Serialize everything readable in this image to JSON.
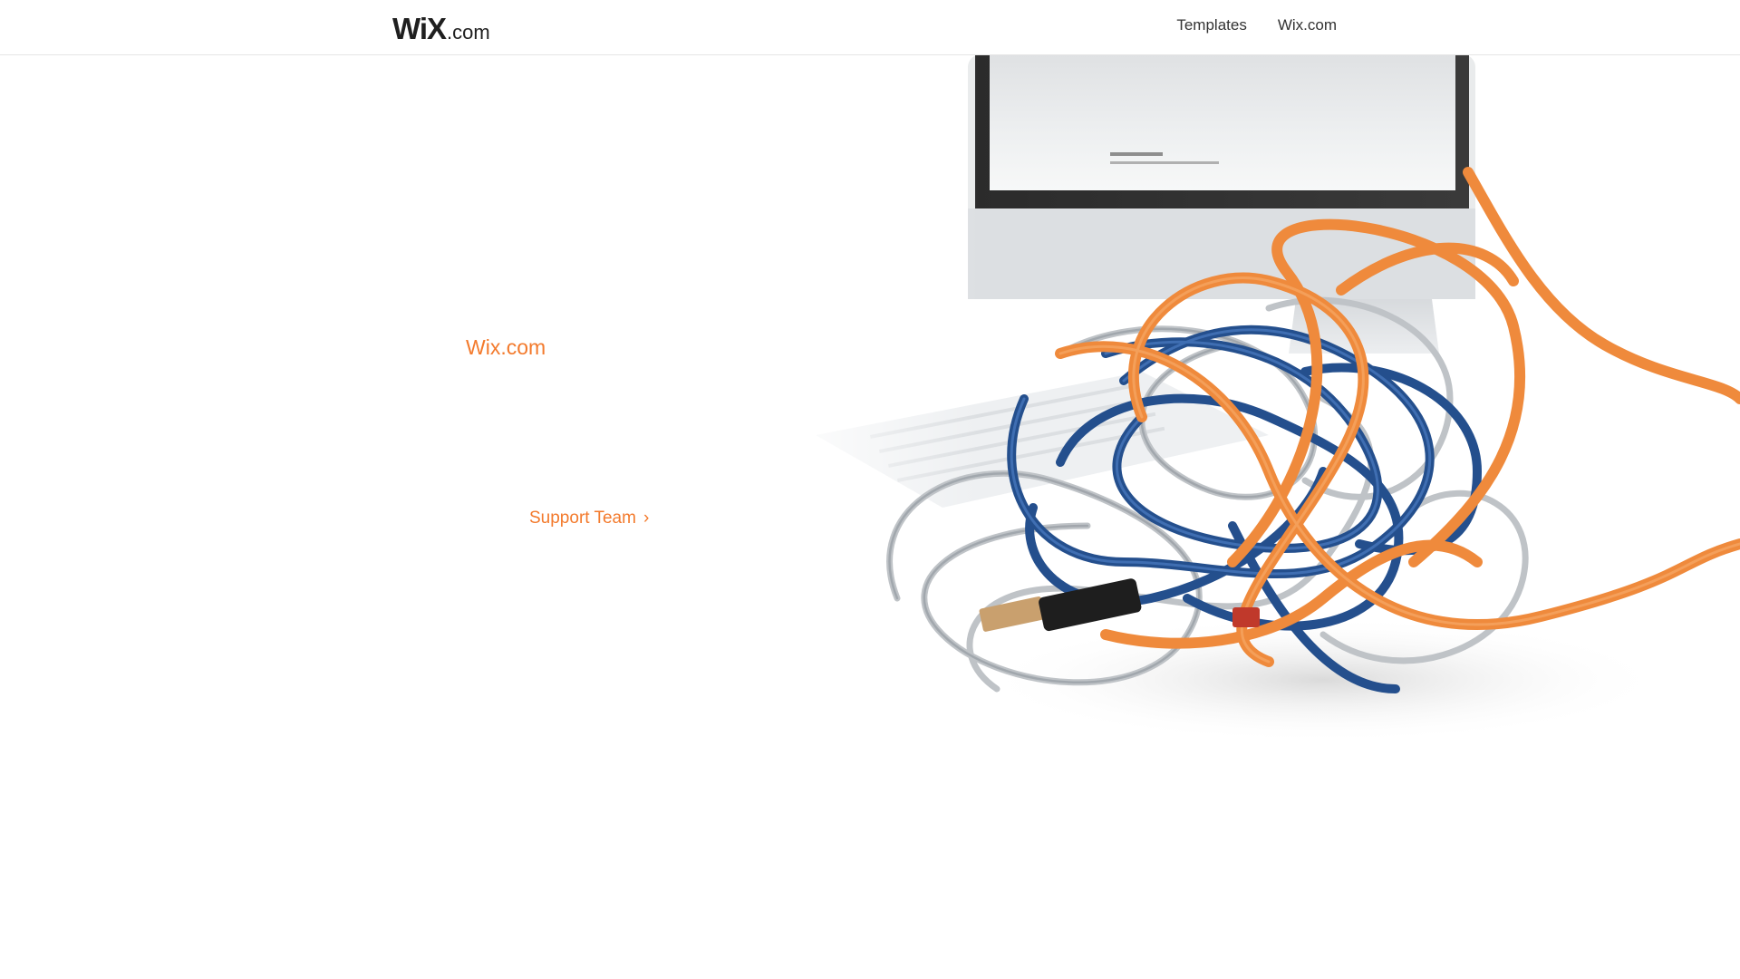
{
  "header": {
    "logo": {
      "wordmark": "WiX",
      "suffix": ".com"
    },
    "nav": [
      {
        "label": "Templates"
      },
      {
        "label": "Wix.com"
      }
    ]
  },
  "main": {
    "site_name": "Wix.com",
    "support_link": {
      "label": "Support Team",
      "icon": "chevron-right-icon"
    }
  },
  "illustration": {
    "description_icon": "tangled-cables-computer-image"
  },
  "colors": {
    "accent": "#f37a2c",
    "nav_text": "#333333",
    "logo": "#1f1f1f"
  }
}
